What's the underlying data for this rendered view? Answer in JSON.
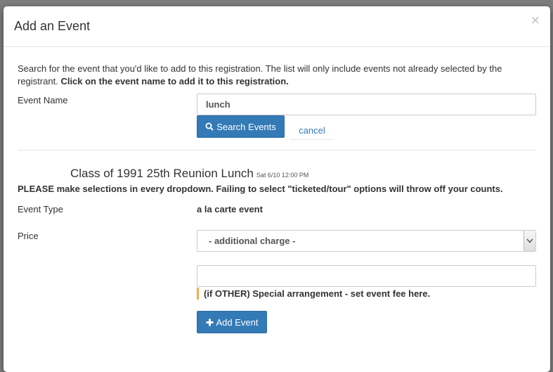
{
  "modal": {
    "title": "Add an Event",
    "close_glyph": "×",
    "intro_text": "Search for the event that you'd like to add to this registration. The list will only include events not already selected by the registrant.",
    "intro_bold": "Click on the event name to add it to this registration."
  },
  "search": {
    "label": "Event Name",
    "value": "lunch",
    "button_label": "Search Events",
    "button_icon": "search-icon",
    "cancel_label": "cancel"
  },
  "event": {
    "title": "Class of 1991 25th Reunion Lunch",
    "date": "Sat 6/10 12:00 PM",
    "warning": "PLEASE make selections in every dropdown. Failing to select \"ticketed/tour\" options will throw off your counts.",
    "type_label": "Event Type",
    "type_value": "a la carte event",
    "price_label": "Price",
    "price_selected": "- additional charge -",
    "other_value": "",
    "other_help": "(if OTHER) Special arrangement - set event fee here.",
    "add_button_label": "Add Event",
    "add_button_icon": "plus-icon"
  },
  "colors": {
    "primary": "#337ab7",
    "help_accent": "#f0ad4e"
  }
}
